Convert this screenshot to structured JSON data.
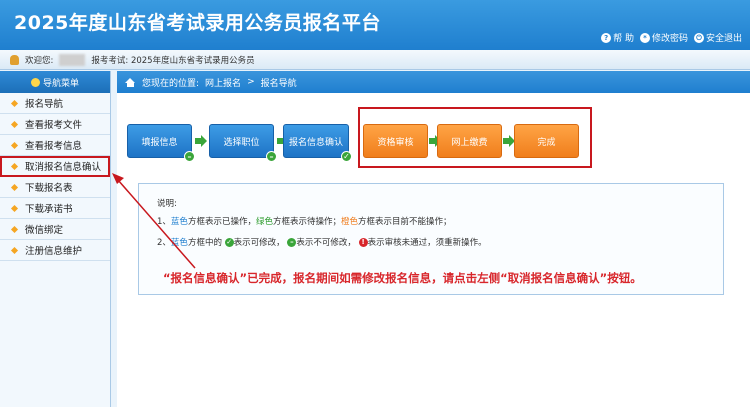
{
  "header": {
    "title": "2025年度山东省考试录用公务员报名平台",
    "links": [
      {
        "icon": "help-icon",
        "label": "帮 助"
      },
      {
        "icon": "password-icon",
        "label": "修改密码"
      },
      {
        "icon": "logout-icon",
        "label": "安全退出"
      }
    ]
  },
  "userbar": {
    "welcome": "欢迎您:",
    "exam_label": "报考考试: 2025年度山东省考试录用公务员"
  },
  "sidebar": {
    "title": "导航菜单",
    "items": [
      {
        "label": "报名导航"
      },
      {
        "label": "查看报考文件"
      },
      {
        "label": "查看报考信息"
      },
      {
        "label": "取消报名信息确认"
      },
      {
        "label": "下载报名表"
      },
      {
        "label": "下载承诺书"
      },
      {
        "label": "微信绑定"
      },
      {
        "label": "注册信息维护"
      }
    ]
  },
  "breadcrumb": {
    "prefix": "您现在的位置:",
    "part1": "网上报名",
    "sep": ">",
    "part2": "报名导航"
  },
  "steps": [
    {
      "label": "填报信息",
      "color": "blue",
      "badge": "–"
    },
    {
      "label": "选择职位",
      "color": "blue",
      "badge": "–"
    },
    {
      "label": "报名信息确认",
      "color": "blue",
      "badge": "✓"
    },
    {
      "label": "资格审核",
      "color": "orange",
      "badge": ""
    },
    {
      "label": "网上缴费",
      "color": "orange",
      "badge": ""
    },
    {
      "label": "完成",
      "color": "orange",
      "badge": ""
    }
  ],
  "notes": {
    "title": "说明:",
    "line1": {
      "prefix": "1、",
      "blue": "蓝色",
      "t1": "方框表示已操作，",
      "green": "绿色",
      "t2": "方框表示待操作；",
      "orange": "橙色",
      "t3": "方框表示目前不能操作；"
    },
    "line2": {
      "prefix": "2、",
      "blue": "蓝色",
      "t1": "方框中的",
      "t2": "表示可修改，",
      "t3": "表示不可修改，",
      "t4": "表示审核未通过，须重新操作。"
    },
    "notice": "“报名信息确认”已完成，报名期间如需修改报名信息，请点击左侧“取消报名信息确认”按钮。"
  },
  "colors": {
    "accent": "#1f7fcf",
    "highlight_red": "#c8181e",
    "step_blue": "#1e73c6",
    "step_orange": "#f07e1c",
    "ok_green": "#3aa53a"
  }
}
